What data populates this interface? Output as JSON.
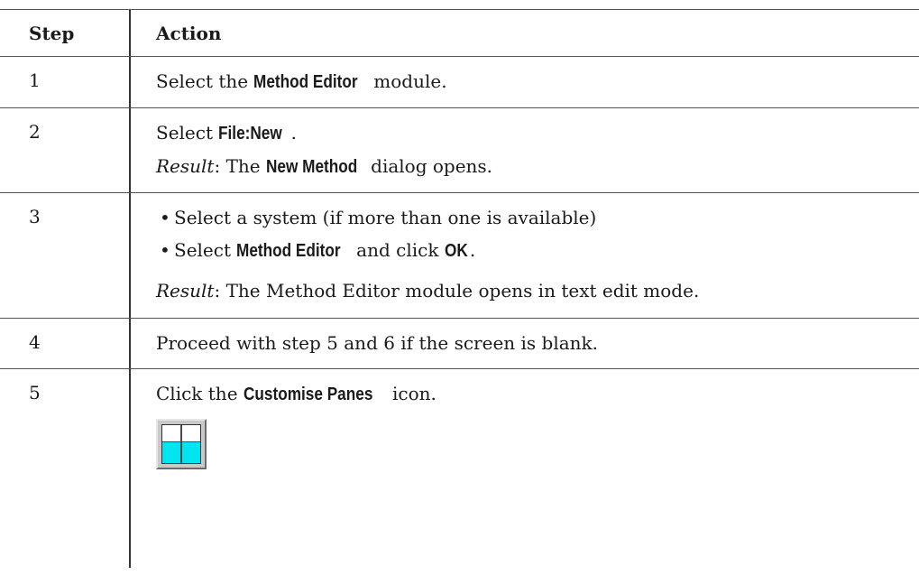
{
  "table": {
    "headers": {
      "step": "Step",
      "action": "Action"
    },
    "rows": [
      {
        "step": "1",
        "a_pre": "Select the ",
        "a_ui": "Method Editor",
        "a_post": " module."
      },
      {
        "step": "2",
        "a_pre": "Select ",
        "a_ui": "File:New",
        "a_post": ".",
        "r_label": "Result",
        "r_pre": ": The ",
        "r_ui": "New Method",
        "r_post": " dialog opens."
      },
      {
        "step": "3",
        "b1": "Select a system (if more than one is available)",
        "b2_pre": "Select ",
        "b2_ui": "Method Editor",
        "b2_mid": " and click ",
        "b2_ui2": "OK",
        "b2_post": ".",
        "r_label": "Result",
        "r_text": ": The Method Editor module opens in text edit mode."
      },
      {
        "step": "4",
        "text": "Proceed with step 5 and 6 if the screen is blank."
      },
      {
        "step": "5",
        "a_pre": "Click the ",
        "a_ui": "Customise Panes",
        "a_post": " icon.",
        "icon": "customise-panes-icon"
      }
    ]
  },
  "bullet_char": "•",
  "colors": {
    "icon_fill": "#00e5ef",
    "icon_frame": "#c9c9c9"
  }
}
